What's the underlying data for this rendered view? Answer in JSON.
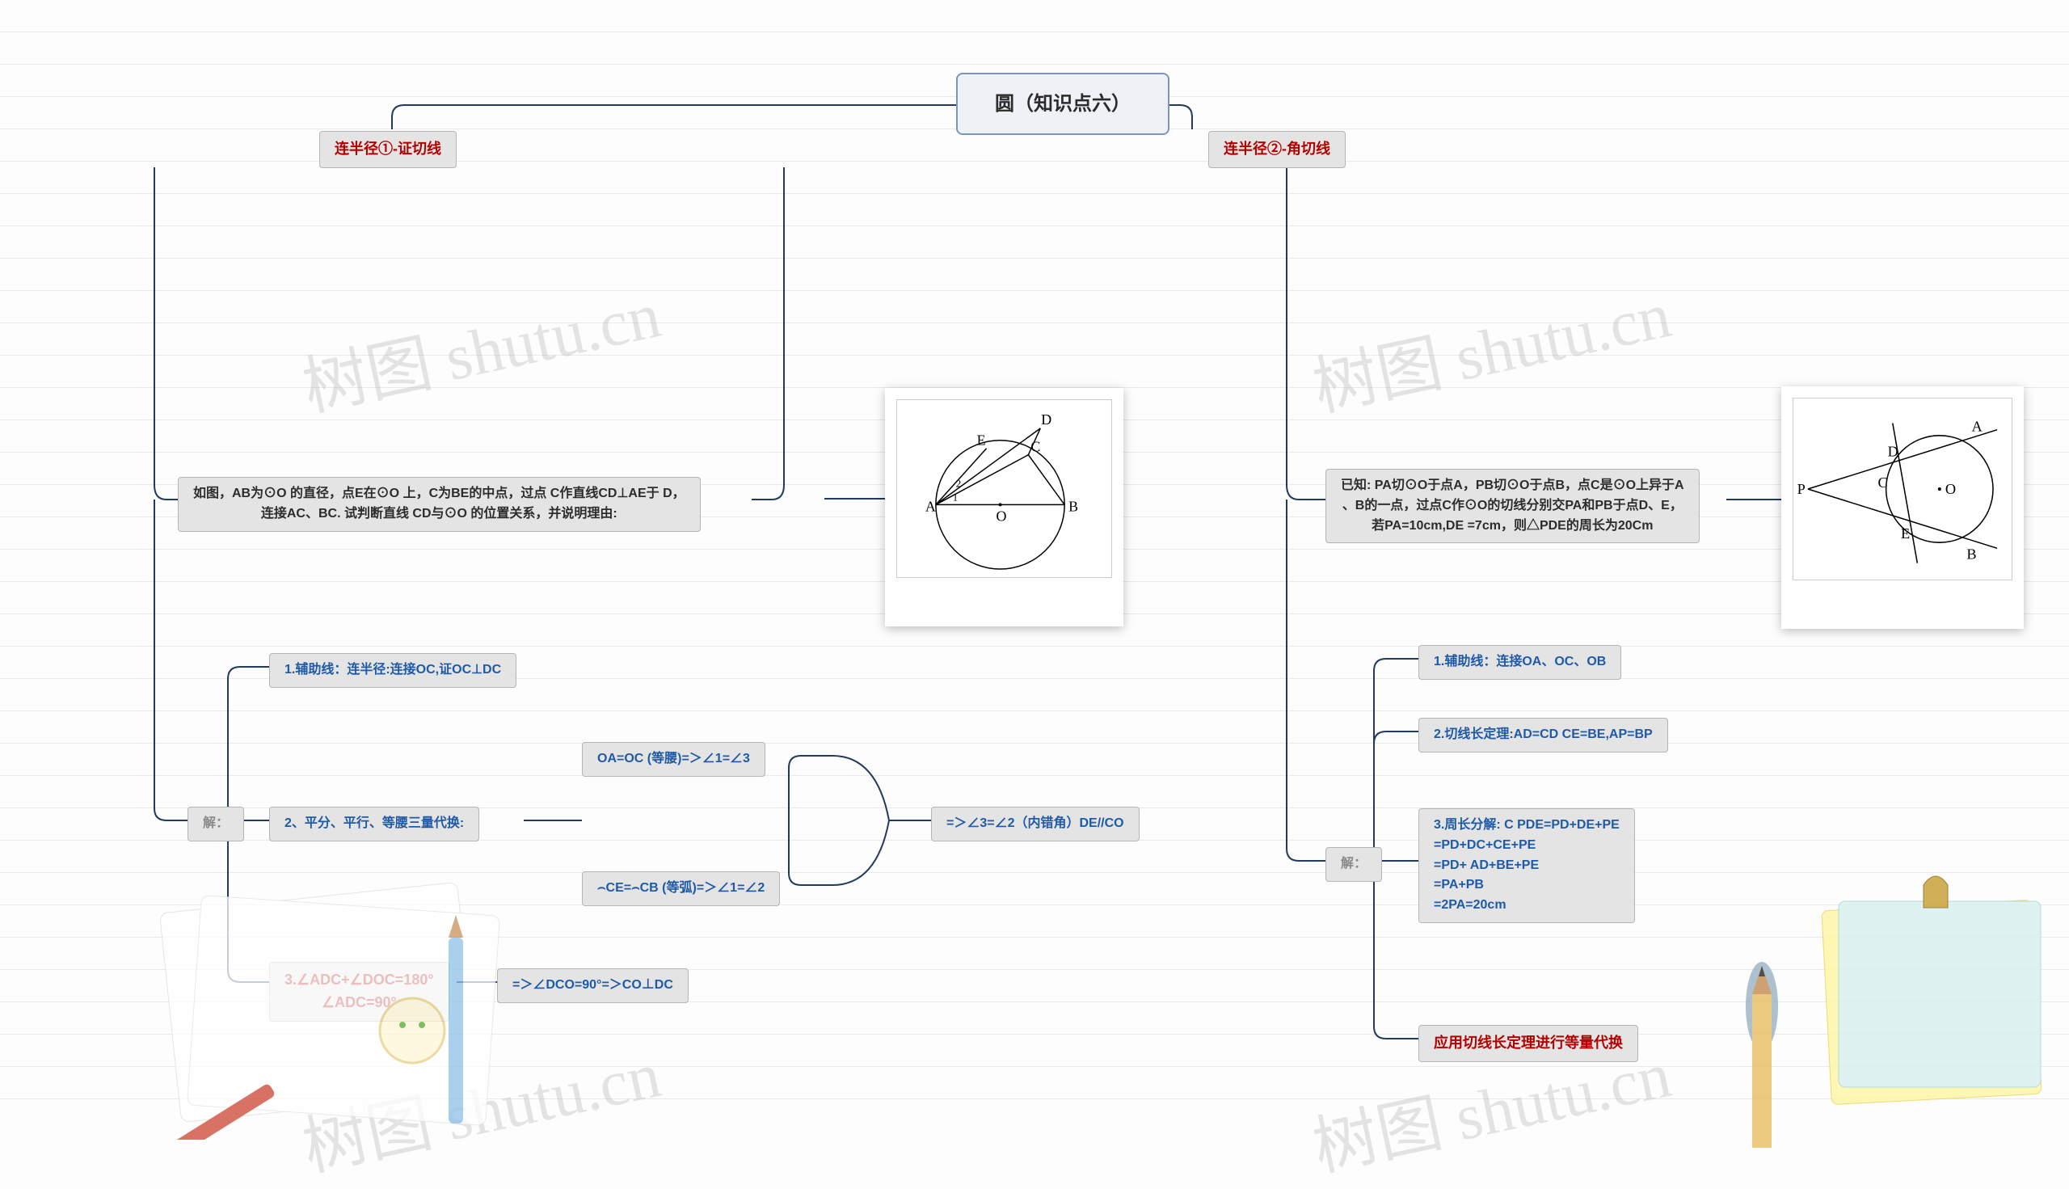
{
  "root": {
    "title": "圆（知识点六）"
  },
  "branch_left": {
    "title": "连半径①-证切线"
  },
  "branch_right": {
    "title": "连半径②-角切线"
  },
  "left": {
    "problem": "如图，AB为⊙O 的直径，点E在⊙O 上，C为BE的中点，过点 C作直线CD⊥AE于 D，\n连接AC、BC. 试判断直线 CD与⊙O 的位置关系，并说明理由:",
    "solve_label": "解：",
    "step1": "1.辅助线：连半径:连接OC,证OC⊥DC",
    "step2": "2、平分、平行、等腰三量代换:",
    "step2a": "OA=OC (等腰)=＞∠1=∠3",
    "step2b": "⌢CE=⌢CB (等弧)=＞∠1=∠2",
    "step2c": "=＞∠3=∠2（内错角）DE//CO",
    "step3": "3.∠ADC+∠DOC=180°\n∠ADC=90°",
    "step3r": "=＞∠DCO=90°=＞CO⊥DC"
  },
  "right": {
    "problem": "已知: PA切⊙O于点A，PB切⊙O于点B，点C是⊙O上异于A\n、B的一点，过点C作⊙O的切线分别交PA和PB于点D、E，\n若PA=10cm,DE =7cm，则△PDE的周长为20Cm",
    "solve_label": "解：",
    "step1": "1.辅助线：连接OA、OC、OB",
    "step2": "2.切线长定理:AD=CD CE=BE,AP=BP",
    "step3": "3.周长分解: C PDE=PD+DE+PE\n=PD+DC+CE+PE\n=PD+ AD+BE+PE\n=PA+PB\n=2PA=20cm",
    "concl": "应用切线长定理进行等量代换"
  },
  "watermark": "树图 shutu.cn",
  "geom": {
    "left": {
      "A": "A",
      "B": "B",
      "C": "C",
      "D": "D",
      "E": "E",
      "O": "O",
      "ang1": "1",
      "ang2": "2"
    },
    "right": {
      "P": "P",
      "A": "A",
      "B": "B",
      "C": "C",
      "D": "D",
      "E": "E",
      "O": "O"
    }
  }
}
